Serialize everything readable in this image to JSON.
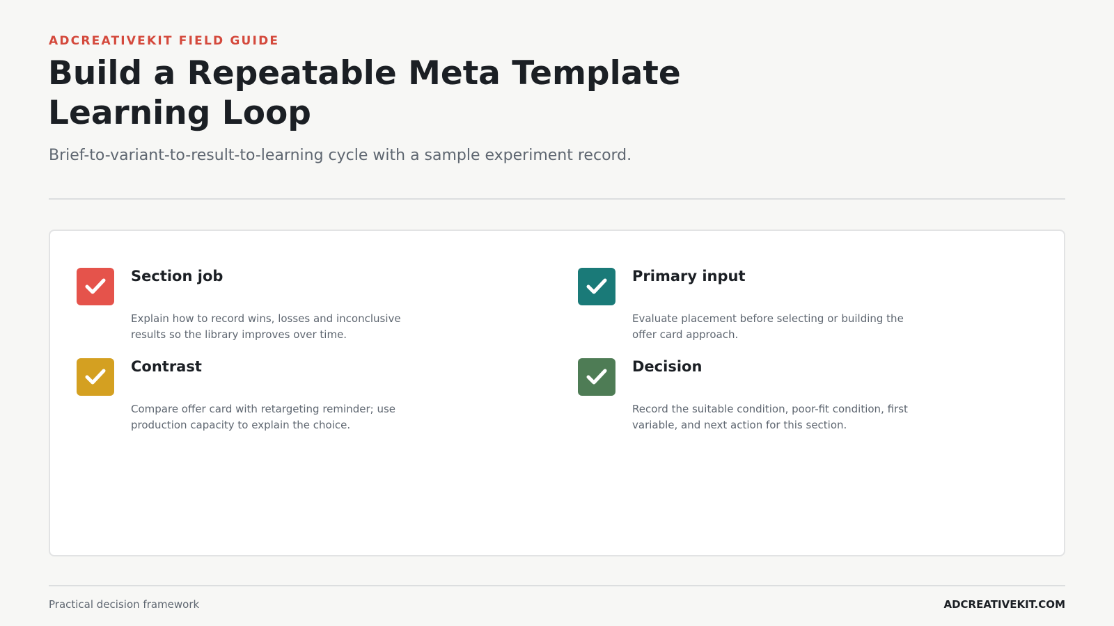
{
  "header": {
    "eyebrow": "ADCREATIVEKIT FIELD GUIDE",
    "title": "Build a Repeatable Meta Template Learning Loop",
    "subtitle": "Brief-to-variant-to-result-to-learning cycle with a sample experiment record."
  },
  "items": [
    {
      "title": "Section job",
      "description": "Explain how to record wins, losses and inconclusive results so the library improves over time.",
      "icon": "check-icon",
      "color": "#e5534b"
    },
    {
      "title": "Primary input",
      "description": "Evaluate placement before selecting or building the offer card approach.",
      "icon": "check-icon",
      "color": "#1a7a78"
    },
    {
      "title": "Contrast",
      "description": "Compare offer card with retargeting reminder; use production capacity to explain the choice.",
      "icon": "check-icon",
      "color": "#d4a021"
    },
    {
      "title": "Decision",
      "description": "Record the suitable condition, poor-fit condition, first variable, and next action for this section.",
      "icon": "check-icon",
      "color": "#4e7c55"
    }
  ],
  "footer": {
    "left": "Practical decision framework",
    "right": "ADCREATIVEKIT.COM"
  }
}
